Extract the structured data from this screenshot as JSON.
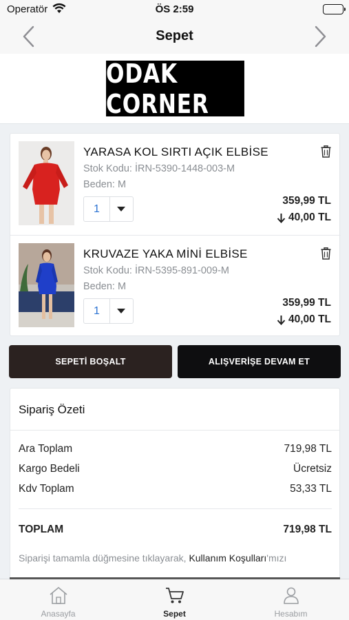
{
  "status_bar": {
    "carrier": "Operatör",
    "time": "ÖS 2:59"
  },
  "nav": {
    "title": "Sepet"
  },
  "logo": {
    "text": "ODAK CORNER"
  },
  "cart": {
    "items": [
      {
        "name": "YARASA KOL SIRTI AÇIK ELBİSE",
        "sku": "Stok Kodu: İRN-5390-1448-003-M",
        "size": "Beden: M",
        "quantity": "1",
        "price": "359,99 TL",
        "discount": "40,00 TL",
        "color": "#d8221f"
      },
      {
        "name": "KRUVAZE YAKA MİNİ ELBİSE",
        "sku": "Stok Kodu: İRN-5395-891-009-M",
        "size": "Beden: M",
        "quantity": "1",
        "price": "359,99 TL",
        "discount": "40,00 TL",
        "color": "#1f3fc9"
      }
    ]
  },
  "buttons": {
    "empty_cart": "SEPETİ BOŞALT",
    "continue_shopping": "ALIŞVERİŞE DEVAM ET"
  },
  "summary": {
    "title": "Sipariş Özeti",
    "rows": [
      {
        "label": "Ara Toplam",
        "value": "719,98 TL"
      },
      {
        "label": "Kargo Bedeli",
        "value": "Ücretsiz"
      },
      {
        "label": "Kdv Toplam",
        "value": "53,33 TL"
      }
    ],
    "total_label": "TOPLAM",
    "total_value": "719,98 TL",
    "terms_prefix": "Siparişi tamamla düğmesine tıklayarak, ",
    "terms_link": "Kullanım Koşulları",
    "terms_suffix": "'mızı"
  },
  "tabs": [
    {
      "label": "Anasayfa",
      "icon": "home-icon"
    },
    {
      "label": "Sepet",
      "icon": "cart-icon",
      "active": true
    },
    {
      "label": "Hesabım",
      "icon": "user-icon"
    }
  ]
}
